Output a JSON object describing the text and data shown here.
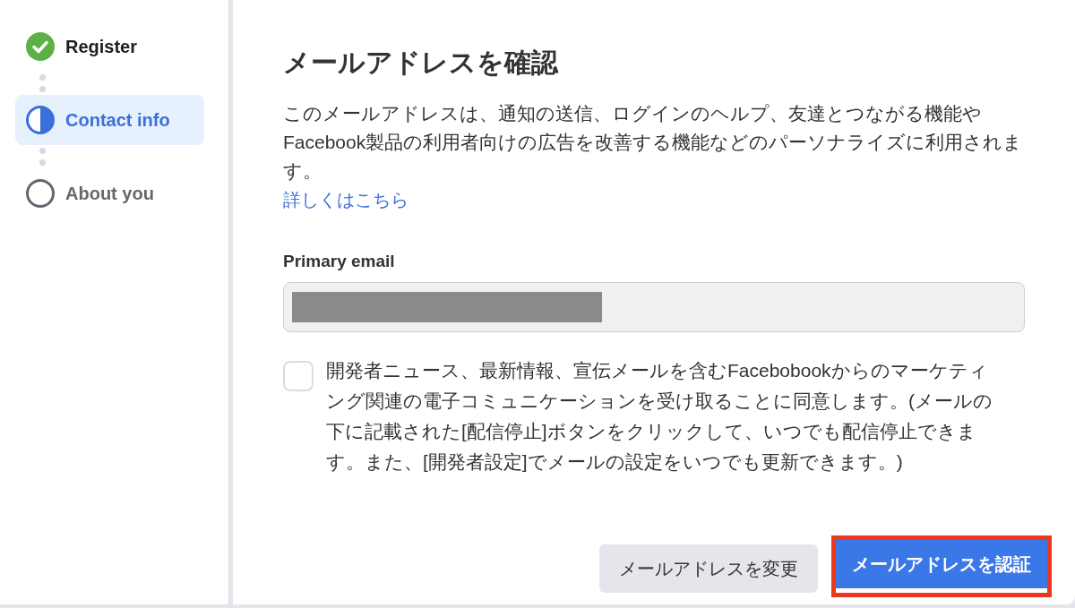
{
  "steps": [
    {
      "label": "Register",
      "kind": "done",
      "selected": false
    },
    {
      "label": "Contact info",
      "kind": "current",
      "selected": true
    },
    {
      "label": "About you",
      "kind": "todo",
      "selected": false
    }
  ],
  "title": "メールアドレスを確認",
  "description": "このメールアドレスは、通知の送信、ログインのヘルプ、友達とつながる機能やFacebook製品の利用者向けの広告を改善する機能などのパーソナライズに利用されます。",
  "learn_more": "詳しくはこちら",
  "email_field": {
    "label": "Primary email",
    "redacted": true
  },
  "consent": {
    "checked": false,
    "text": "開発者ニュース、最新情報、宣伝メールを含むFacebobookからのマーケティング関連の電子コミュニケーションを受け取ることに同意します。(メールの下に記載された[配信停止]ボタンをクリックして、いつでも配信停止できます。また、[開発者設定]でメールの設定をいつでも更新できます。)"
  },
  "buttons": [
    {
      "label": "メールアドレスを変更",
      "kind": "secondary",
      "highlighted": false
    },
    {
      "label": "メールアドレスを認証",
      "kind": "primary",
      "highlighted": true
    }
  ]
}
